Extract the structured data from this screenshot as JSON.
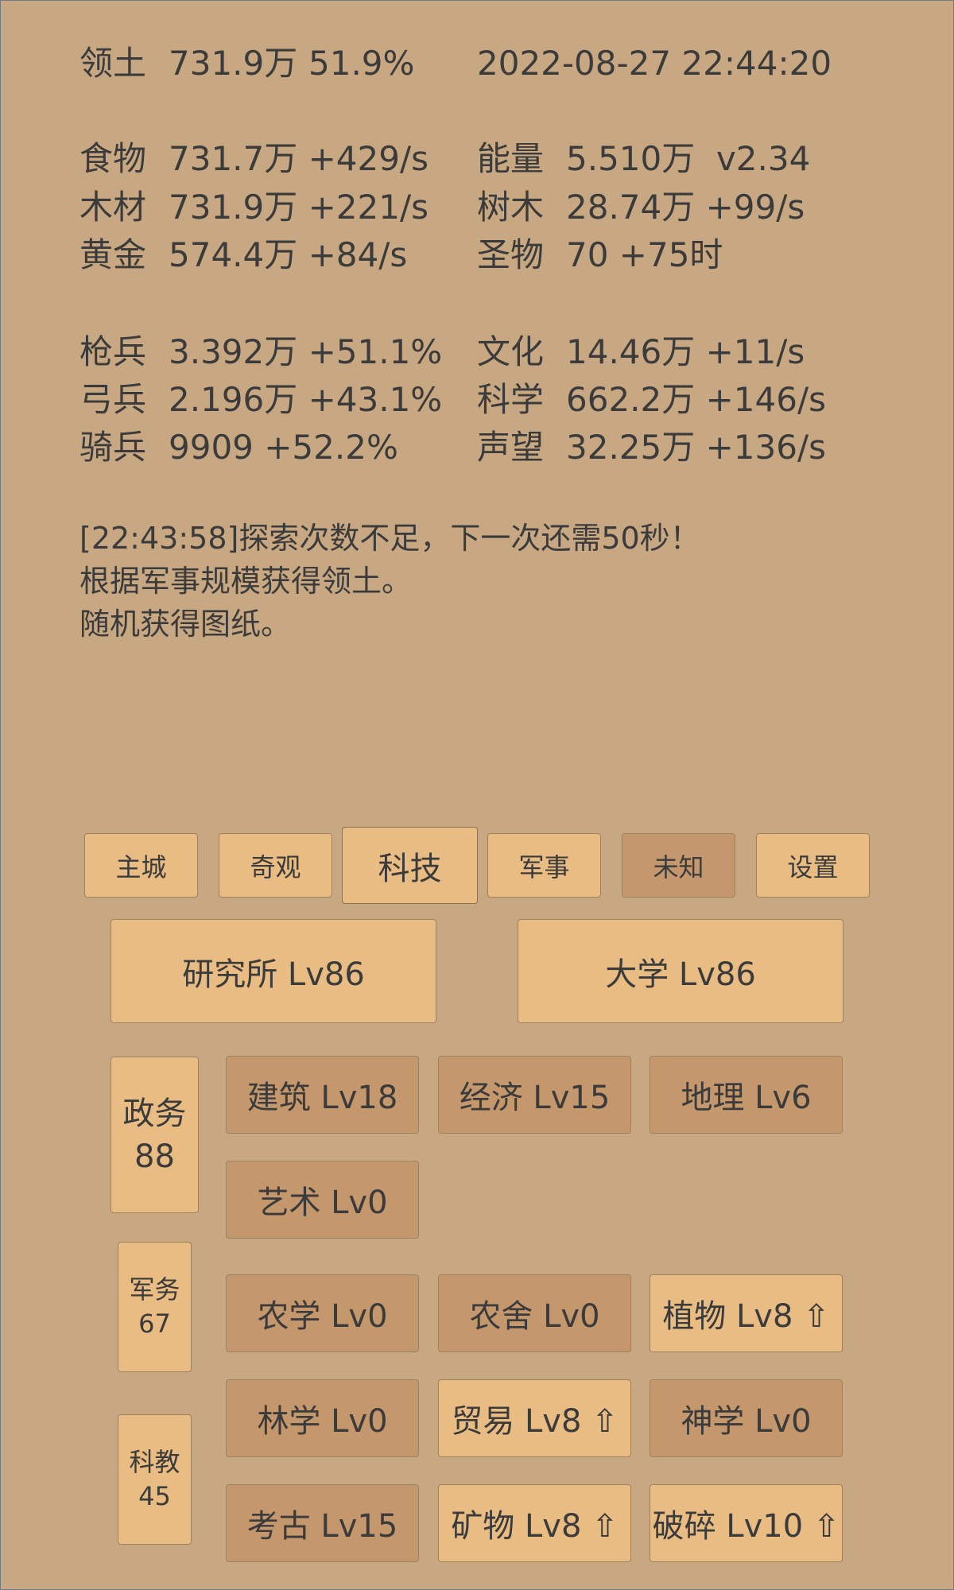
{
  "status": {
    "territory_label": "领土",
    "territory_value": "731.9万",
    "territory_pct": "51.9%",
    "datetime": "2022-08-27 22:44:20"
  },
  "resources": {
    "food": {
      "label": "食物",
      "value": "731.7万 +429/s"
    },
    "wood": {
      "label": "木材",
      "value": "731.9万 +221/s"
    },
    "gold": {
      "label": "黄金",
      "value": "574.4万 +84/s"
    },
    "energy": {
      "label": "能量",
      "value": "5.510万  v2.34"
    },
    "trees": {
      "label": "树木",
      "value": "28.74万 +99/s"
    },
    "relic": {
      "label": "圣物",
      "value": "70 +75时"
    }
  },
  "military": {
    "spear": {
      "label": "枪兵",
      "value": "3.392万 +51.1%"
    },
    "archer": {
      "label": "弓兵",
      "value": "2.196万 +43.1%"
    },
    "cavalry": {
      "label": "骑兵",
      "value": "9909 +52.2%"
    },
    "culture": {
      "label": "文化",
      "value": "14.46万 +11/s"
    },
    "science": {
      "label": "科学",
      "value": "662.2万 +146/s"
    },
    "prestige": {
      "label": "声望",
      "value": "32.25万 +136/s"
    }
  },
  "log": [
    "[22:43:58]探索次数不足，下一次还需50秒！",
    "根据军事规模获得领土。",
    "随机获得图纸。"
  ],
  "tabs": {
    "main_city": "主城",
    "wonders": "奇观",
    "tech": "科技",
    "military": "军事",
    "unknown": "未知",
    "settings": "设置"
  },
  "buildings": {
    "institute": "研究所 Lv86",
    "university": "大学 Lv86"
  },
  "categories": {
    "politics": {
      "label": "政务",
      "count": "88"
    },
    "military": {
      "label": "军务",
      "count": "67"
    },
    "education": {
      "label": "科教",
      "count": "45"
    }
  },
  "skills": {
    "architecture": "建筑 Lv18",
    "economy": "经济 Lv15",
    "geography": "地理 Lv6",
    "art": "艺术 Lv0",
    "agronomy": "农学 Lv0",
    "farmhouse": "农舍 Lv0",
    "botany": "植物 Lv8 ⇧",
    "forestry": "林学 Lv0",
    "trade": "贸易 Lv8 ⇧",
    "theology": "神学 Lv0",
    "archaeology": "考古 Lv15",
    "minerals": "矿物 Lv8 ⇧",
    "crushing": "破碎 Lv10 ⇧"
  }
}
